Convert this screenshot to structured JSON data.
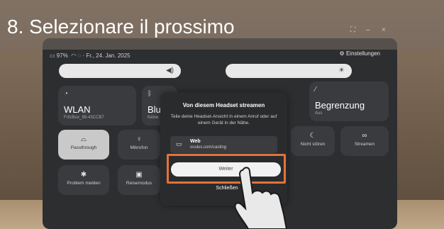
{
  "overlay": {
    "step_title": "8. Selezionare il prossimo"
  },
  "window_controls": {
    "expand": "⛶",
    "minimize": "–",
    "close": "×"
  },
  "status_bar": {
    "battery": "97%",
    "date": "Fr., 24. Jan. 2025",
    "settings_label": "Einstellungen"
  },
  "tiles": {
    "wlan": {
      "title": "WLAN",
      "subtitle": "FritzBox_99-43CCB7"
    },
    "bluetooth": {
      "title": "Blue",
      "subtitle": "Keine"
    },
    "boundary": {
      "title": "Begrenzung",
      "subtitle": "Aus"
    }
  },
  "quick_actions": {
    "passthrough": "Passthrough",
    "mic": "Mikrofon",
    "dnd": "Nicht stören",
    "stream": "Streamen",
    "report": "Problem melden",
    "travel": "Reisemodus"
  },
  "dialog": {
    "title": "Von diesem Headset streamen",
    "description": "Teile deine Headset-Ansicht in einem Anruf oder auf einem Gerät in der Nähe.",
    "option_title": "Web",
    "option_url": "oculus.com/casting",
    "primary_button": "Weiter",
    "close_button": "Schließen"
  },
  "colors": {
    "highlight": "#e2733a",
    "panel": "#2d2e30"
  },
  "icons": [
    "wifi-icon",
    "bluetooth-icon",
    "moon-icon",
    "stream-icon",
    "mic-icon",
    "lock-icon",
    "bug-icon",
    "monitor-icon",
    "gear-icon",
    "sun-icon",
    "speaker-icon"
  ]
}
